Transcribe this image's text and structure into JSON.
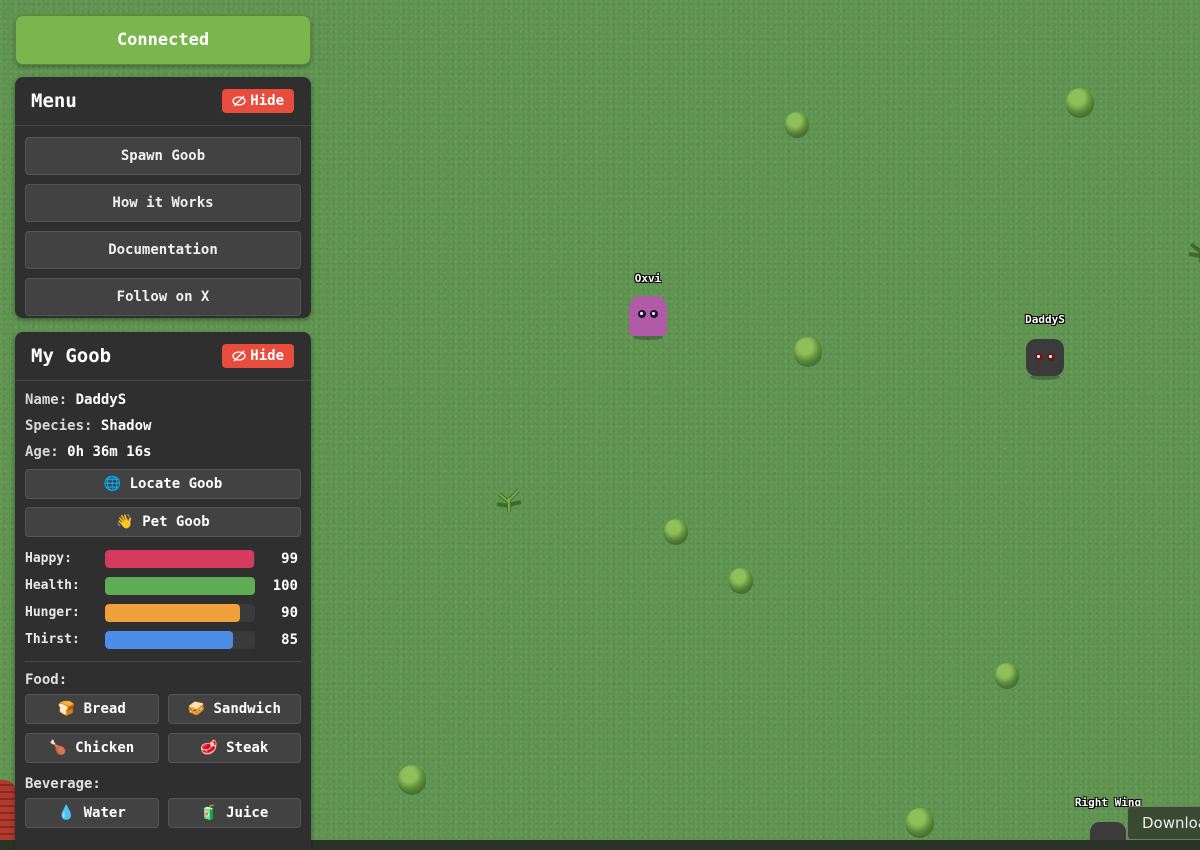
{
  "status": {
    "label": "Connected",
    "color": "#7ab54e"
  },
  "menu": {
    "title": "Menu",
    "hide_label": "Hide",
    "items": [
      "Spawn Goob",
      "How it Works",
      "Documentation",
      "Follow on X"
    ]
  },
  "my_goob": {
    "title": "My Goob",
    "hide_label": "Hide",
    "name_key": "Name:",
    "name": "DaddyS",
    "species_key": "Species:",
    "species": "Shadow",
    "age_key": "Age:",
    "age": "0h 36m 16s",
    "locate_label": "Locate Goob",
    "pet_label": "Pet Goob",
    "stats": [
      {
        "label": "Happy:",
        "value": 99,
        "color": "#d63a5e"
      },
      {
        "label": "Health:",
        "value": 100,
        "color": "#5fae55"
      },
      {
        "label": "Hunger:",
        "value": 90,
        "color": "#f0a038"
      },
      {
        "label": "Thirst:",
        "value": 85,
        "color": "#4a8ee8"
      }
    ],
    "food_label": "Food:",
    "food": [
      "Bread",
      "Sandwich",
      "Chicken",
      "Steak"
    ],
    "beverage_label": "Beverage:",
    "beverage": [
      "Water",
      "Juice"
    ]
  },
  "world": {
    "goobs": [
      {
        "name": "Oxvi",
        "color": "#b05aa8"
      },
      {
        "name": "DaddyS",
        "color": "#3b3b3b"
      },
      {
        "name": "Right Wing",
        "color": "#3b3b3b"
      }
    ]
  },
  "tooltip": "Download"
}
